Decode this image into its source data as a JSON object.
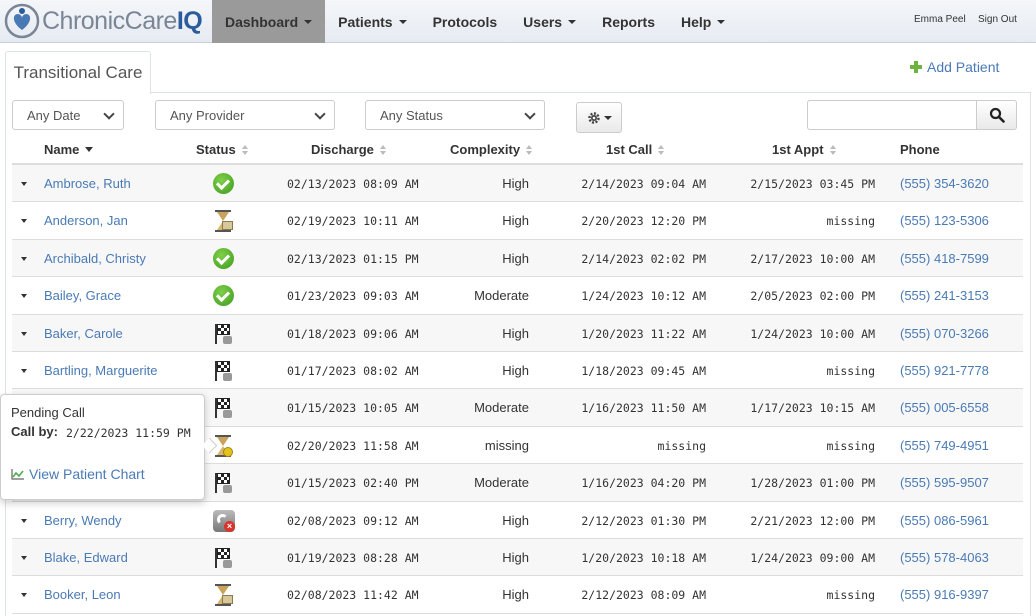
{
  "app": {
    "logo_text_main": "ChronicCare",
    "logo_text_accent": "IQ"
  },
  "nav": {
    "items": [
      {
        "label": "Dashboard",
        "dropdown": true,
        "active": true
      },
      {
        "label": "Patients",
        "dropdown": true
      },
      {
        "label": "Protocols",
        "dropdown": false
      },
      {
        "label": "Users",
        "dropdown": true
      },
      {
        "label": "Reports",
        "dropdown": false
      },
      {
        "label": "Help",
        "dropdown": true
      }
    ],
    "user_name": "Emma Peel",
    "sign_out": "Sign Out"
  },
  "tab": {
    "label": "Transitional Care"
  },
  "actions": {
    "add_patient": "Add Patient"
  },
  "filters": {
    "date": "Any Date",
    "provider": "Any Provider",
    "status": "Any Status",
    "search_value": ""
  },
  "columns": {
    "name": "Name",
    "status": "Status",
    "discharge": "Discharge",
    "complexity": "Complexity",
    "first_call": "1st Call",
    "first_appt": "1st Appt",
    "phone": "Phone"
  },
  "rows": [
    {
      "name": "Ambrose, Ruth",
      "status": "complete",
      "discharge": "02/13/2023 08:09 AM",
      "complexity": "High",
      "first_call": "2/14/2023 09:04 AM",
      "first_appt": "2/15/2023 03:45 PM",
      "phone": "(555) 354-3620"
    },
    {
      "name": "Anderson, Jan",
      "status": "pending",
      "discharge": "02/19/2023 10:11 AM",
      "complexity": "High",
      "first_call": "2/20/2023 12:20 PM",
      "first_appt": "missing",
      "phone": "(555) 123-5306"
    },
    {
      "name": "Archibald, Christy",
      "status": "complete",
      "discharge": "02/13/2023 01:15 PM",
      "complexity": "High",
      "first_call": "2/14/2023 02:02 PM",
      "first_appt": "2/17/2023 10:00 AM",
      "phone": "(555) 418-7599"
    },
    {
      "name": "Bailey, Grace",
      "status": "complete",
      "discharge": "01/23/2023 09:03 AM",
      "complexity": "Moderate",
      "first_call": "1/24/2023 10:12 AM",
      "first_appt": "2/05/2023 02:00 PM",
      "phone": "(555) 241-3153"
    },
    {
      "name": "Baker, Carole",
      "status": "finished",
      "discharge": "01/18/2023 09:06 AM",
      "complexity": "High",
      "first_call": "1/20/2023 11:22 AM",
      "first_appt": "1/24/2023 10:00 AM",
      "phone": "(555) 070-3266"
    },
    {
      "name": "Bartling, Marguerite",
      "status": "finished",
      "discharge": "01/17/2023 08:02 AM",
      "complexity": "High",
      "first_call": "1/18/2023 09:45 AM",
      "first_appt": "missing",
      "phone": "(555) 921-7778"
    },
    {
      "name": "",
      "status": "finished",
      "discharge": "01/15/2023 10:05 AM",
      "complexity": "Moderate",
      "first_call": "1/16/2023 11:50 AM",
      "first_appt": "1/17/2023 10:15 AM",
      "phone": "(555) 005-6558"
    },
    {
      "name": "",
      "status": "pending-call",
      "discharge": "02/20/2023 11:58 AM",
      "complexity": "missing",
      "first_call": "missing",
      "first_appt": "missing",
      "phone": "(555) 749-4951"
    },
    {
      "name": "",
      "status": "finished",
      "discharge": "01/15/2023 02:40 PM",
      "complexity": "Moderate",
      "first_call": "1/16/2023 04:20 PM",
      "first_appt": "1/28/2023 01:00 PM",
      "phone": "(555) 595-9507"
    },
    {
      "name": "Berry, Wendy",
      "status": "call-failed",
      "discharge": "02/08/2023 09:12 AM",
      "complexity": "High",
      "first_call": "2/12/2023 01:30 PM",
      "first_appt": "2/21/2023 12:00 PM",
      "phone": "(555) 086-5961"
    },
    {
      "name": "Blake, Edward",
      "status": "finished",
      "discharge": "01/19/2023 08:28 AM",
      "complexity": "High",
      "first_call": "1/20/2023 10:18 AM",
      "first_appt": "1/24/2023 09:00 AM",
      "phone": "(555) 578-4063"
    },
    {
      "name": "Booker, Leon",
      "status": "pending",
      "discharge": "02/08/2023 11:42 AM",
      "complexity": "High",
      "first_call": "2/12/2023 08:09 AM",
      "first_appt": "missing",
      "phone": "(555) 916-9397"
    }
  ],
  "popover": {
    "title": "Pending Call",
    "call_by_label": "Call by:",
    "call_by_value": "2/22/2023 11:59 PM",
    "link": "View Patient Chart"
  },
  "colors": {
    "link": "#4a7ab5",
    "active_nav": "#9a9a9a",
    "add_icon": "#6db33f"
  }
}
